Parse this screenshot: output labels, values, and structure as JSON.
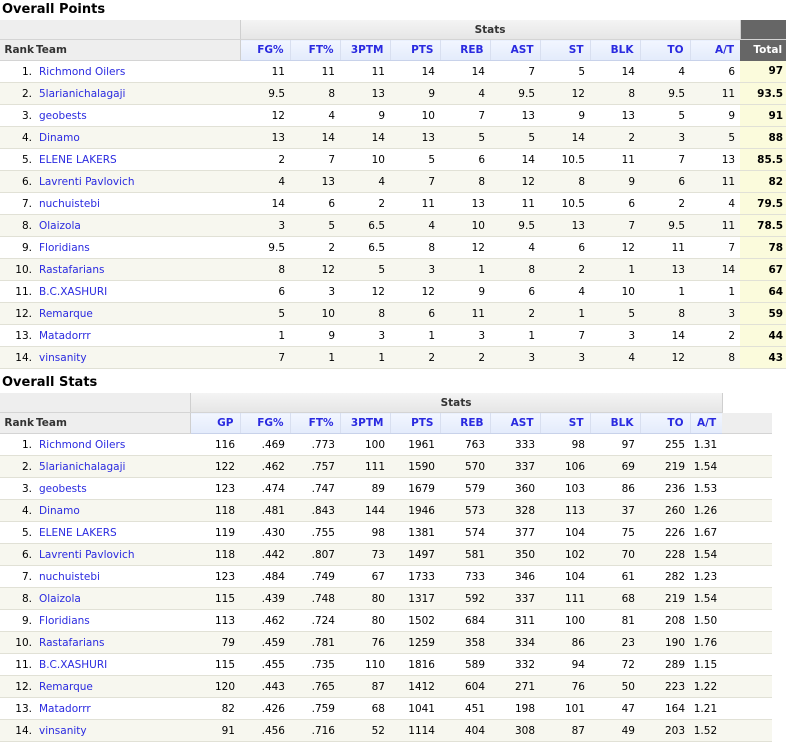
{
  "points": {
    "title": "Overall Points",
    "group_label": "Stats",
    "headers": {
      "rank": "Rank",
      "team": "Team",
      "total": "Total"
    },
    "stat_headers": [
      "FG%",
      "FT%",
      "3PTM",
      "PTS",
      "REB",
      "AST",
      "ST",
      "BLK",
      "TO",
      "A/T"
    ],
    "rows": [
      {
        "rank": "1.",
        "team": "Richmond Oilers",
        "vals": [
          "11",
          "11",
          "11",
          "14",
          "14",
          "7",
          "5",
          "14",
          "4",
          "6"
        ],
        "total": "97"
      },
      {
        "rank": "2.",
        "team": "5larianichalagaji",
        "vals": [
          "9.5",
          "8",
          "13",
          "9",
          "4",
          "9.5",
          "12",
          "8",
          "9.5",
          "11"
        ],
        "total": "93.5"
      },
      {
        "rank": "3.",
        "team": "geobests",
        "vals": [
          "12",
          "4",
          "9",
          "10",
          "7",
          "13",
          "9",
          "13",
          "5",
          "9"
        ],
        "total": "91"
      },
      {
        "rank": "4.",
        "team": "Dinamo",
        "vals": [
          "13",
          "14",
          "14",
          "13",
          "5",
          "5",
          "14",
          "2",
          "3",
          "5"
        ],
        "total": "88"
      },
      {
        "rank": "5.",
        "team": "ELENE LAKERS",
        "vals": [
          "2",
          "7",
          "10",
          "5",
          "6",
          "14",
          "10.5",
          "11",
          "7",
          "13"
        ],
        "total": "85.5"
      },
      {
        "rank": "6.",
        "team": "Lavrenti Pavlovich",
        "vals": [
          "4",
          "13",
          "4",
          "7",
          "8",
          "12",
          "8",
          "9",
          "6",
          "11"
        ],
        "total": "82"
      },
      {
        "rank": "7.",
        "team": "nuchuistebi",
        "vals": [
          "14",
          "6",
          "2",
          "11",
          "13",
          "11",
          "10.5",
          "6",
          "2",
          "4"
        ],
        "total": "79.5"
      },
      {
        "rank": "8.",
        "team": "Olaizola",
        "vals": [
          "3",
          "5",
          "6.5",
          "4",
          "10",
          "9.5",
          "13",
          "7",
          "9.5",
          "11"
        ],
        "total": "78.5"
      },
      {
        "rank": "9.",
        "team": "Floridians",
        "vals": [
          "9.5",
          "2",
          "6.5",
          "8",
          "12",
          "4",
          "6",
          "12",
          "11",
          "7"
        ],
        "total": "78"
      },
      {
        "rank": "10.",
        "team": "Rastafarians",
        "vals": [
          "8",
          "12",
          "5",
          "3",
          "1",
          "8",
          "2",
          "1",
          "13",
          "14"
        ],
        "total": "67"
      },
      {
        "rank": "11.",
        "team": "B.C.XASHURI",
        "vals": [
          "6",
          "3",
          "12",
          "12",
          "9",
          "6",
          "4",
          "10",
          "1",
          "1"
        ],
        "total": "64"
      },
      {
        "rank": "12.",
        "team": "Remarque",
        "vals": [
          "5",
          "10",
          "8",
          "6",
          "11",
          "2",
          "1",
          "5",
          "8",
          "3"
        ],
        "total": "59"
      },
      {
        "rank": "13.",
        "team": "Matadorrr",
        "vals": [
          "1",
          "9",
          "3",
          "1",
          "3",
          "1",
          "7",
          "3",
          "14",
          "2"
        ],
        "total": "44"
      },
      {
        "rank": "14.",
        "team": "vinsanity",
        "vals": [
          "7",
          "1",
          "1",
          "2",
          "2",
          "3",
          "3",
          "4",
          "12",
          "8"
        ],
        "total": "43"
      }
    ]
  },
  "stats": {
    "title": "Overall Stats",
    "group_label": "Stats",
    "headers": {
      "rank": "Rank",
      "team": "Team"
    },
    "stat_headers": [
      "GP",
      "FG%",
      "FT%",
      "3PTM",
      "PTS",
      "REB",
      "AST",
      "ST",
      "BLK",
      "TO",
      "A/T"
    ],
    "rows": [
      {
        "rank": "1.",
        "team": "Richmond Oilers",
        "vals": [
          "116",
          ".469",
          ".773",
          "100",
          "1961",
          "763",
          "333",
          "98",
          "97",
          "255",
          "1.31"
        ]
      },
      {
        "rank": "2.",
        "team": "5larianichalagaji",
        "vals": [
          "122",
          ".462",
          ".757",
          "111",
          "1590",
          "570",
          "337",
          "106",
          "69",
          "219",
          "1.54"
        ]
      },
      {
        "rank": "3.",
        "team": "geobests",
        "vals": [
          "123",
          ".474",
          ".747",
          "89",
          "1679",
          "579",
          "360",
          "103",
          "86",
          "236",
          "1.53"
        ]
      },
      {
        "rank": "4.",
        "team": "Dinamo",
        "vals": [
          "118",
          ".481",
          ".843",
          "144",
          "1946",
          "573",
          "328",
          "113",
          "37",
          "260",
          "1.26"
        ]
      },
      {
        "rank": "5.",
        "team": "ELENE LAKERS",
        "vals": [
          "119",
          ".430",
          ".755",
          "98",
          "1381",
          "574",
          "377",
          "104",
          "75",
          "226",
          "1.67"
        ]
      },
      {
        "rank": "6.",
        "team": "Lavrenti Pavlovich",
        "vals": [
          "118",
          ".442",
          ".807",
          "73",
          "1497",
          "581",
          "350",
          "102",
          "70",
          "228",
          "1.54"
        ]
      },
      {
        "rank": "7.",
        "team": "nuchuistebi",
        "vals": [
          "123",
          ".484",
          ".749",
          "67",
          "1733",
          "733",
          "346",
          "104",
          "61",
          "282",
          "1.23"
        ]
      },
      {
        "rank": "8.",
        "team": "Olaizola",
        "vals": [
          "115",
          ".439",
          ".748",
          "80",
          "1317",
          "592",
          "337",
          "111",
          "68",
          "219",
          "1.54"
        ]
      },
      {
        "rank": "9.",
        "team": "Floridians",
        "vals": [
          "113",
          ".462",
          ".724",
          "80",
          "1502",
          "684",
          "311",
          "100",
          "81",
          "208",
          "1.50"
        ]
      },
      {
        "rank": "10.",
        "team": "Rastafarians",
        "vals": [
          "79",
          ".459",
          ".781",
          "76",
          "1259",
          "358",
          "334",
          "86",
          "23",
          "190",
          "1.76"
        ]
      },
      {
        "rank": "11.",
        "team": "B.C.XASHURI",
        "vals": [
          "115",
          ".455",
          ".735",
          "110",
          "1816",
          "589",
          "332",
          "94",
          "72",
          "289",
          "1.15"
        ]
      },
      {
        "rank": "12.",
        "team": "Remarque",
        "vals": [
          "120",
          ".443",
          ".765",
          "87",
          "1412",
          "604",
          "271",
          "76",
          "50",
          "223",
          "1.22"
        ]
      },
      {
        "rank": "13.",
        "team": "Matadorrr",
        "vals": [
          "82",
          ".426",
          ".759",
          "68",
          "1041",
          "451",
          "198",
          "101",
          "47",
          "164",
          "1.21"
        ]
      },
      {
        "rank": "14.",
        "team": "vinsanity",
        "vals": [
          "91",
          ".456",
          ".716",
          "52",
          "1114",
          "404",
          "308",
          "87",
          "49",
          "203",
          "1.52"
        ]
      }
    ]
  }
}
